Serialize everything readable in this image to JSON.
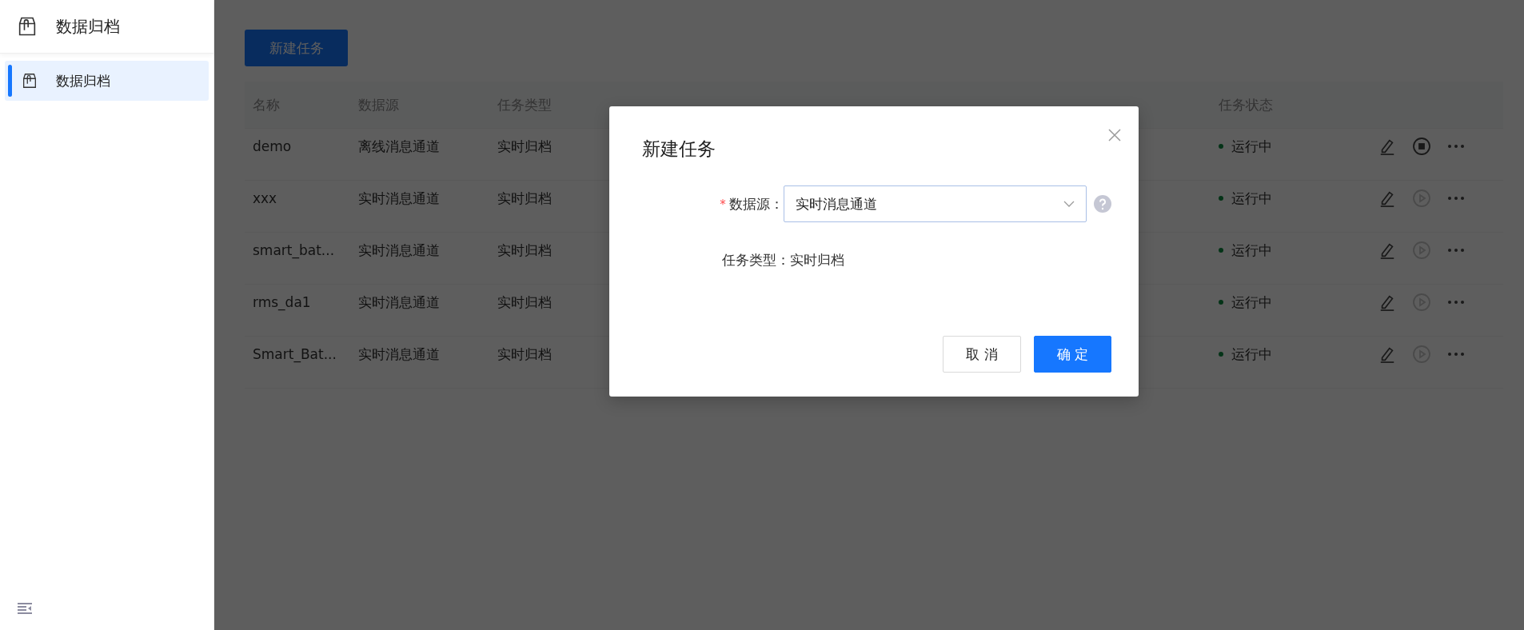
{
  "sidebar": {
    "title": "数据归档",
    "items": [
      {
        "label": "数据归档",
        "selected": true
      }
    ]
  },
  "toolbar": {
    "new_button": "新建任务"
  },
  "table": {
    "columns": [
      {
        "label": "名称"
      },
      {
        "label": "数据源"
      },
      {
        "label": "任务类型"
      },
      {
        "label": "任务状态"
      }
    ],
    "rows": [
      {
        "name": "demo",
        "source": "离线消息通道",
        "type": "实时归档",
        "status": "运行中",
        "action": {
          "kind": "stop",
          "disabled": false
        }
      },
      {
        "name": "xxx",
        "source": "实时消息通道",
        "type": "实时归档",
        "status": "运行中",
        "action": {
          "kind": "play",
          "disabled": true
        }
      },
      {
        "name": "smart_bat...",
        "source": "实时消息通道",
        "type": "实时归档",
        "status": "运行中",
        "action": {
          "kind": "play",
          "disabled": true
        }
      },
      {
        "name": "rms_da1",
        "source": "实时消息通道",
        "type": "实时归档",
        "status": "运行中",
        "action": {
          "kind": "play",
          "disabled": true
        }
      },
      {
        "name": "Smart_Bat...",
        "source": "实时消息通道",
        "type": "实时归档",
        "status": "运行中",
        "action": {
          "kind": "play",
          "disabled": true
        }
      }
    ]
  },
  "modal": {
    "title": "新建任务",
    "fields": [
      {
        "kind": "select",
        "required_mark": "*",
        "label": "数据源：",
        "value": "实时消息通道"
      },
      {
        "kind": "text",
        "label": "任务类型：",
        "value": "实时归档"
      }
    ],
    "buttons": [
      {
        "label": "取 消",
        "primary": false
      },
      {
        "label": "确 定",
        "primary": true
      }
    ]
  }
}
